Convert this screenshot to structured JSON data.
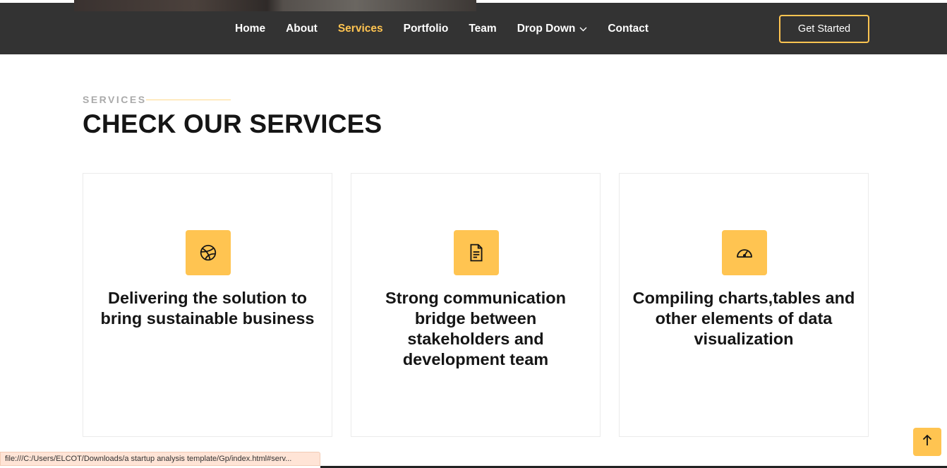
{
  "nav": {
    "items": [
      {
        "label": "Home",
        "active": false
      },
      {
        "label": "About",
        "active": false
      },
      {
        "label": "Services",
        "active": true
      },
      {
        "label": "Portfolio",
        "active": false
      },
      {
        "label": "Team",
        "active": false
      },
      {
        "label": "Drop Down",
        "active": false,
        "has_dropdown": true
      },
      {
        "label": "Contact",
        "active": false
      }
    ],
    "cta_label": "Get Started"
  },
  "section": {
    "label": "SERVICES",
    "title": "CHECK OUR SERVICES"
  },
  "services": [
    {
      "icon": "dribbble-icon",
      "title": "Delivering the solution to bring sustainable business"
    },
    {
      "icon": "file-text-icon",
      "title": "Strong communication bridge between stakeholders and development team"
    },
    {
      "icon": "speedometer-icon",
      "title": "Compiling charts,tables and other elements of data visualization"
    }
  ],
  "status_bar": {
    "url": "file:///C:/Users/ELCOT/Downloads/a startup analysis template/Gp/index.html#serv..."
  },
  "colors": {
    "accent": "#ffc451",
    "header_bg": "#333333"
  }
}
